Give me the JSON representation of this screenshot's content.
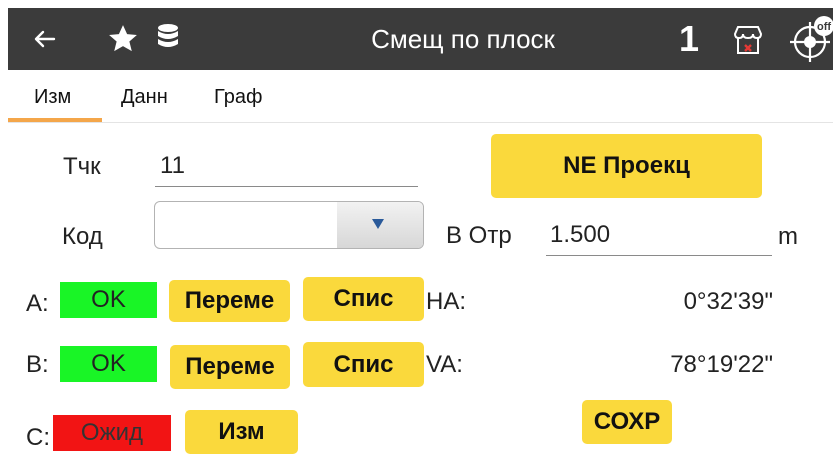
{
  "header": {
    "title": "Смещ по плоск",
    "count": "1",
    "gps_badge": "off",
    "icons": [
      "back-arrow-icon",
      "star-icon",
      "database-icon",
      "store-icon",
      "gps-crosshair-icon"
    ]
  },
  "tabs": [
    {
      "label": "Изм",
      "active": true
    },
    {
      "label": "Данн",
      "active": false
    },
    {
      "label": "Граф",
      "active": false
    }
  ],
  "form": {
    "point_label": "Тчк",
    "point_value": "11",
    "code_label": "Код",
    "code_value": "",
    "height_label": "В Отр",
    "height_value": "1.500",
    "height_unit": "m",
    "ne_project_button": "NE Проекц"
  },
  "measurements": {
    "a_label": "A:",
    "a_status": "OK",
    "b_label": "B:",
    "b_status": "OK",
    "c_label": "C:",
    "c_status": "Ожид",
    "move_button": "Переме",
    "list_button": "Спис",
    "measure_button": "Изм",
    "ha_label": "HA:",
    "ha_value": "0°32'39\"",
    "va_label": "VA:",
    "va_value": "78°19'22\"",
    "save_button": "СОХР"
  },
  "colors": {
    "header_bg": "#3b3b3b",
    "accent_yellow": "#fad93c",
    "tab_underline": "#f4a64a",
    "status_ok": "#19f526",
    "status_wait": "#f21414"
  }
}
